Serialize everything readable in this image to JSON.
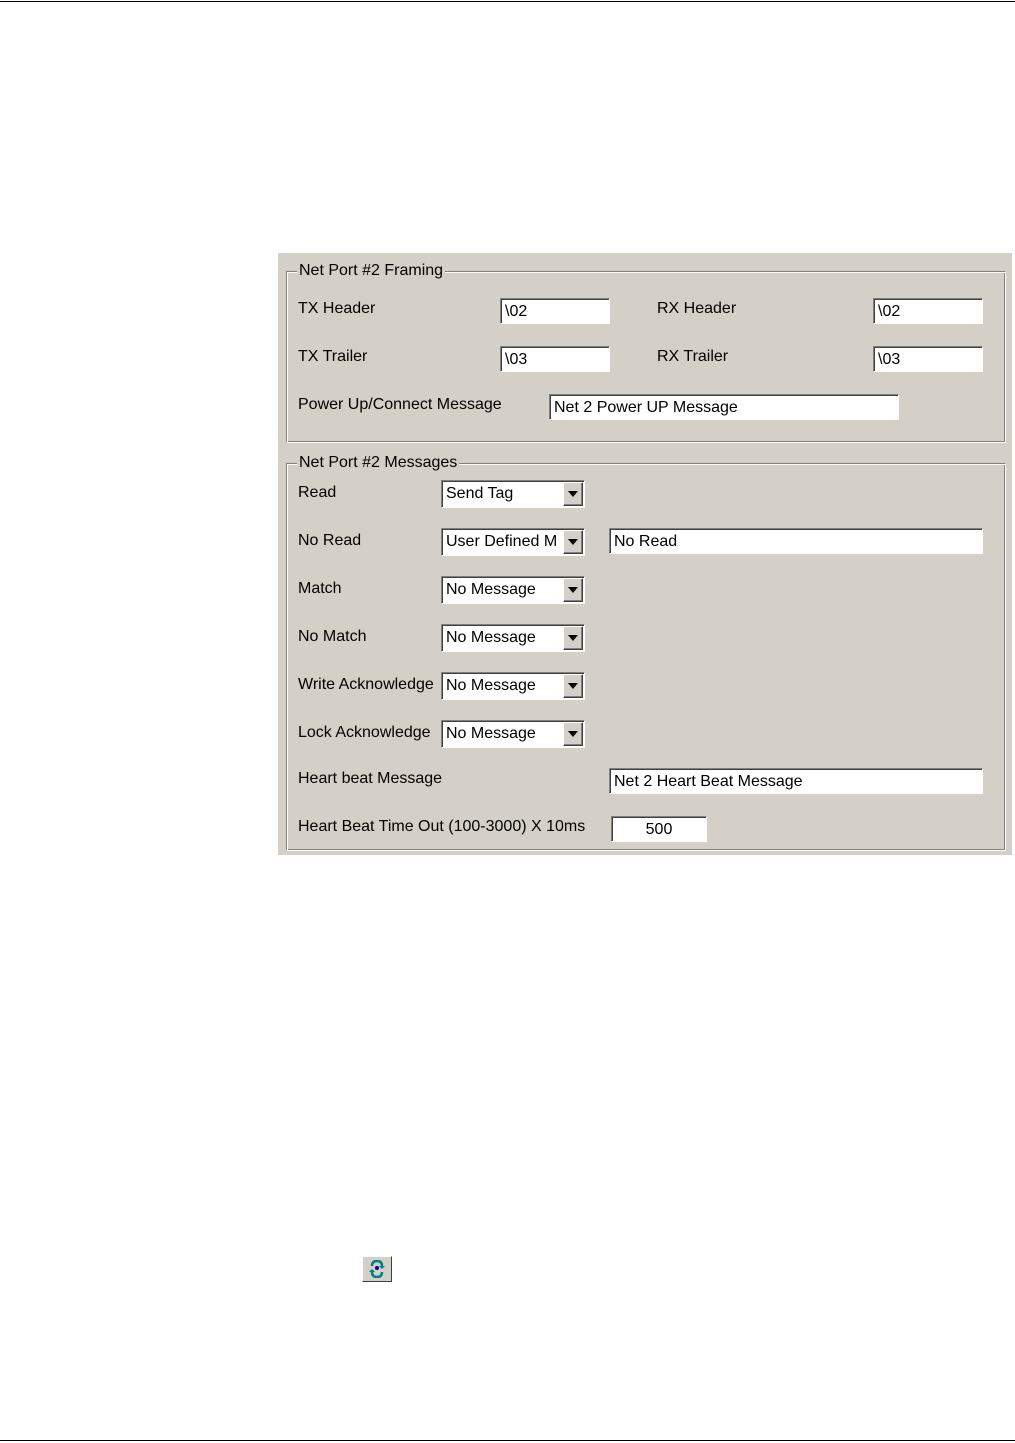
{
  "framing": {
    "title": "Net Port #2 Framing",
    "tx_header_label": "TX Header",
    "tx_header_value": "\\02",
    "rx_header_label": "RX Header",
    "rx_header_value": "\\02",
    "tx_trailer_label": "TX Trailer",
    "tx_trailer_value": "\\03",
    "rx_trailer_label": "RX Trailer",
    "rx_trailer_value": "\\03",
    "power_up_label": "Power Up/Connect Message",
    "power_up_value": "Net 2 Power UP Message"
  },
  "messages": {
    "title": "Net Port #2 Messages",
    "read_label": "Read",
    "read_value": "Send Tag",
    "no_read_label": "No Read",
    "no_read_value": "User Defined M",
    "no_read_text": "No Read",
    "match_label": "Match",
    "match_value": "No Message",
    "no_match_label": "No Match",
    "no_match_value": "No Message",
    "write_ack_label": "Write Acknowledge",
    "write_ack_value": "No Message",
    "lock_ack_label": "Lock Acknowledge",
    "lock_ack_value": "No Message",
    "heartbeat_label": "Heart beat Message",
    "heartbeat_value": "Net 2 Heart Beat Message",
    "heartbeat_timeout_label": "Heart Beat Time Out (100-3000) X 10ms",
    "heartbeat_timeout_value": "500"
  },
  "icons": {
    "help": "help-icon"
  }
}
